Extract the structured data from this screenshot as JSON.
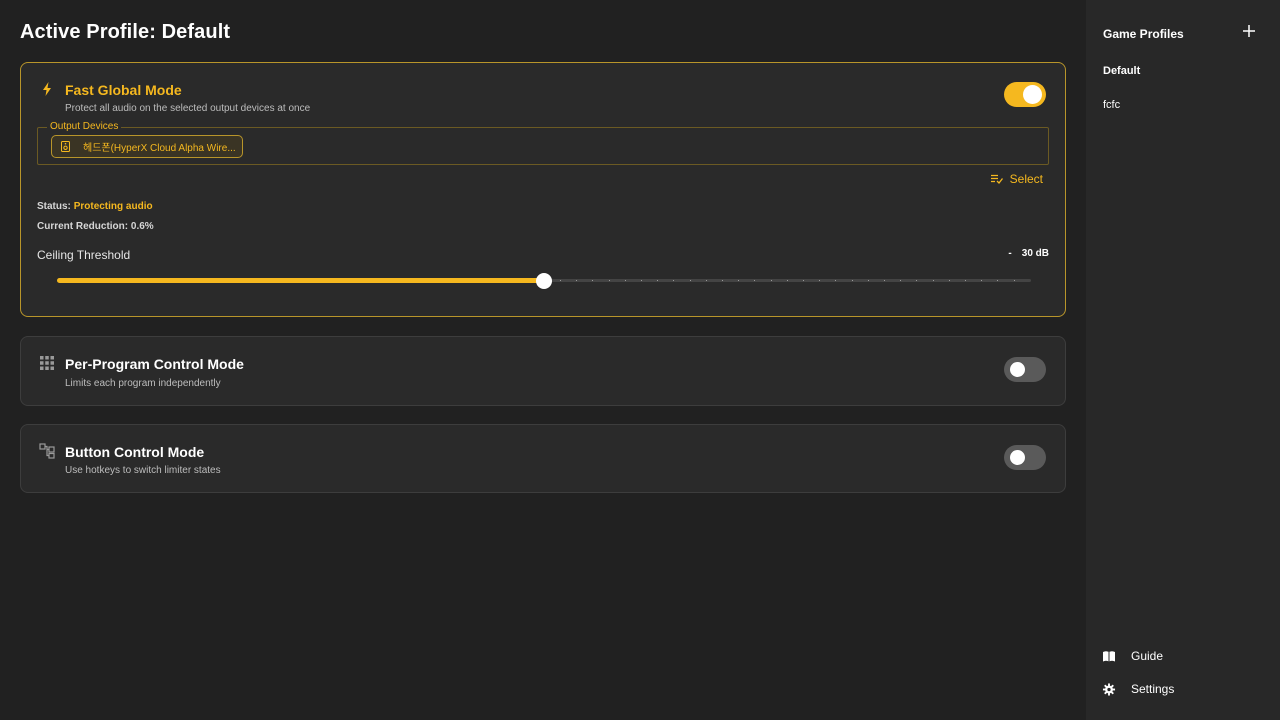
{
  "page_title": "Active Profile: Default",
  "modes": {
    "fast_global": {
      "title": "Fast Global Mode",
      "description": "Protect all audio on the selected output devices at once",
      "enabled": true,
      "icon": "lightning-icon",
      "output_devices_label": "Output Devices",
      "device_chip": "헤드폰(HyperX Cloud Alpha Wire...",
      "select_label": "Select",
      "status_label": "Status:",
      "status_value": "Protecting audio",
      "reduction_label": "Current Reduction:",
      "reduction_value": "0.6%",
      "threshold_label": "Ceiling Threshold",
      "threshold_sign": "-",
      "threshold_value": "30 dB",
      "threshold_level_fraction": 0.5
    },
    "per_program": {
      "title": "Per-Program Control Mode",
      "description": "Limits each program independently",
      "enabled": false,
      "icon": "grid-icon"
    },
    "button_control": {
      "title": "Button Control Mode",
      "description": "Use hotkeys to switch limiter states",
      "enabled": false,
      "icon": "hotkey-icon"
    }
  },
  "sidebar": {
    "title": "Game Profiles",
    "add_icon": "plus-icon",
    "profiles": [
      "Default",
      "fcfc"
    ],
    "selected_profile": "Default",
    "links": [
      {
        "label": "Guide",
        "icon": "book-icon"
      },
      {
        "label": "Settings",
        "icon": "gear-icon"
      }
    ]
  },
  "colors": {
    "accent": "#f5b81f",
    "background": "#212121",
    "card": "#2a2a2a",
    "sidebar": "#282828"
  }
}
